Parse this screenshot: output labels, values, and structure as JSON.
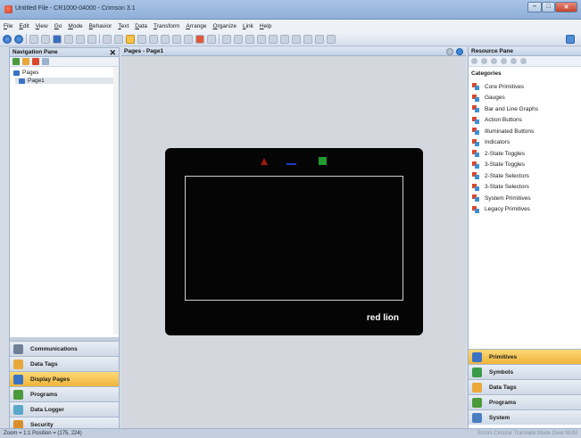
{
  "window": {
    "title": "Untitled File - CR1000-04000 - Crimson 3.1",
    "controls": {
      "minimize": "–",
      "maximize": "□",
      "close": "✕"
    }
  },
  "menu": [
    "File",
    "Edit",
    "View",
    "Go",
    "Mode",
    "Behavior",
    "Text",
    "Data",
    "Transform",
    "Arrange",
    "Organize",
    "Link",
    "Help"
  ],
  "navigation_pane": {
    "title": "Navigation Pane",
    "close_label": "✕",
    "tree": {
      "root": "Pages",
      "child": "Page1"
    },
    "buttons": [
      {
        "label": "Communications",
        "color": "#6f7f96",
        "active": false
      },
      {
        "label": "Data Tags",
        "color": "#e8a83a",
        "active": false
      },
      {
        "label": "Display Pages",
        "color": "#3b73c4",
        "active": true
      },
      {
        "label": "Programs",
        "color": "#4c9a3c",
        "active": false
      },
      {
        "label": "Data Logger",
        "color": "#5aa7c9",
        "active": false
      },
      {
        "label": "Security",
        "color": "#d88e2a",
        "active": false
      }
    ]
  },
  "editor": {
    "title": "Pages - Page1",
    "logo_text": "red lion",
    "colors": {
      "led_red": "#9b1a0e",
      "led_blue": "#1d3bbf",
      "led_green": "#1f9a2e",
      "bezel": "#050505"
    }
  },
  "resource_pane": {
    "title": "Resource Pane",
    "categories_label": "Categories",
    "categories": [
      "Core Primitives",
      "Gauges",
      "Bar and Line Graphs",
      "Action Buttons",
      "Illuminated Buttons",
      "Indicators",
      "2-State Toggles",
      "3-State Toggles",
      "2-State Selectors",
      "3-State Selectors",
      "System Primitives",
      "Legacy Primitives"
    ],
    "buttons": [
      {
        "label": "Primitives",
        "color": "#3b73c4",
        "active": true
      },
      {
        "label": "Symbols",
        "color": "#3a9a4a",
        "active": false
      },
      {
        "label": "Data Tags",
        "color": "#e8a83a",
        "active": false
      },
      {
        "label": "Programs",
        "color": "#4c9a3c",
        "active": false
      },
      {
        "label": "System",
        "color": "#4a7ec0",
        "active": false
      }
    ]
  },
  "status_bar": {
    "text": "Zoom = 1:1  Position = (175, 224)",
    "right_text": "Errors  Circular  Translate  Mode  Over  NUM"
  }
}
